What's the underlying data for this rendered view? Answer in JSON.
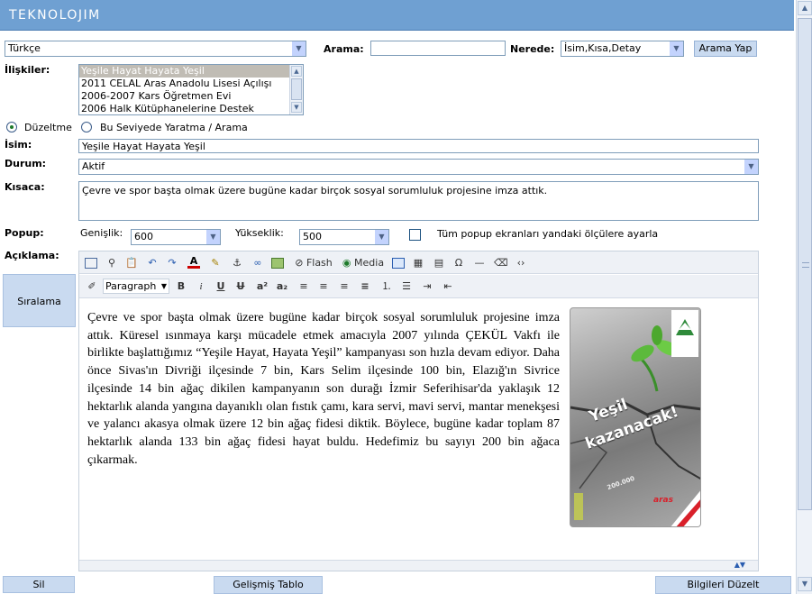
{
  "header": {
    "logo": "TEKNOLOJIM"
  },
  "language_select": {
    "value": "Türkçe"
  },
  "search": {
    "label": "Arama:",
    "value": "",
    "where_label": "Nerede:",
    "where_value": "İsim,Kısa,Detay",
    "button": "Arama Yap"
  },
  "relations": {
    "label": "İlişkiler:",
    "items": [
      "Yeşile Hayat Hayata Yeşil",
      "2011 CELAL Aras Anadolu Lisesi Açılışı",
      "2006-2007 Kars Öğretmen Evi",
      "2006 Halk Kütüphanelerine Destek"
    ],
    "selected_index": 0
  },
  "mode": {
    "edit_label": "Düzeltme",
    "create_label": "Bu Seviyede Yaratma / Arama",
    "selected": "edit"
  },
  "name": {
    "label": "İsim:",
    "value": "Yeşile Hayat Hayata Yeşil"
  },
  "status": {
    "label": "Durum:",
    "value": "Aktif"
  },
  "summary": {
    "label": "Kısaca:",
    "value": "Çevre ve spor başta olmak üzere bugüne kadar birçok sosyal sorumluluk projesine imza attık."
  },
  "popup": {
    "label": "Popup:",
    "width_label": "Genişlik:",
    "width_value": "600",
    "height_label": "Yükseklik:",
    "height_value": "500",
    "all_label": "Tüm popup ekranları yandaki ölçülere ayarla",
    "all_checked": false
  },
  "description": {
    "label": "Açıklama:",
    "toolbar1": {
      "flash": "Flash",
      "media": "Media"
    },
    "toolbar2": {
      "format": "Paragraph"
    },
    "content": "Çevre ve spor başta olmak üzere bugüne kadar birçok sosyal sorumluluk projesine imza attık. Küresel ısınmaya karşı mücadele etmek amacıyla 2007 yılında ÇEKÜL Vakfı ile birlikte başlattığımız “Yeşile Hayat, Hayata Yeşil” kampanyası son hızla devam ediyor. Daha önce Sivas'ın Divriği ilçesinde 7 bin, Kars Selim ilçesinde 100 bin, Elazığ'ın Sivrice ilçesinde 14 bin ağaç dikilen kampanyanın son durağı İzmir Seferihisar'da yaklaşık 12 hektarlık alanda yangına dayanıklı olan fıstık çamı, kara servi, mavi servi, mantar menekşesi ve yalancı akasya olmak üzere 12 bin ağaç fidesi diktik. Böylece, bugüne kadar toplam 87 hektarlık alanda 133 bin ağaç fidesi hayat buldu. Hedefimiz bu sayıyı 200 bin ağaca çıkarmak.",
    "poster": {
      "headline_1": "Yeşil",
      "headline_2": "kazanacak!",
      "number": "200.000",
      "brand": "aras"
    }
  },
  "side": {
    "sort_button": "Sıralama"
  },
  "footer": {
    "delete": "Sil",
    "advanced_table": "Gelişmiş Tablo",
    "update": "Bilgileri Düzelt"
  },
  "colors": {
    "header": "#6fa0d2",
    "button": "#c9daf0",
    "accent": "#2b63a7"
  }
}
